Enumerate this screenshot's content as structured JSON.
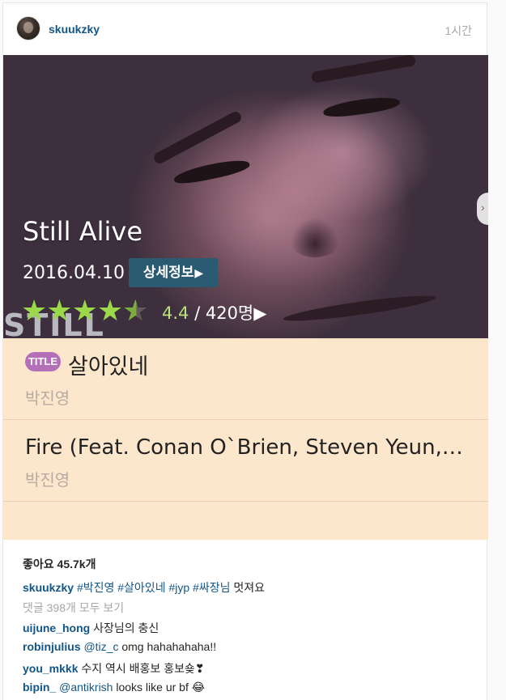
{
  "post": {
    "username": "skuukzky",
    "time_ago": "1시간"
  },
  "photo": {
    "still_letters": "STILL",
    "album_title": "Still Alive",
    "release_date": "2016.04.10",
    "detail_button": "상세정보",
    "detail_arrow": "▶",
    "rating_stars": 4.4,
    "rating_value": "4.4",
    "rating_count": "/ 420명▶",
    "rating_color": "#9bd84a",
    "tracks": [
      {
        "badge": "TITLE",
        "name": "살아있네",
        "artist": "박진영"
      },
      {
        "name": "Fire (Feat. Conan O`Brien, Steven Yeun,…",
        "artist": "박진영"
      }
    ]
  },
  "meta": {
    "likes": "좋아요 45.7k개",
    "caption": {
      "username": "skuukzky",
      "tags": [
        "#박진영",
        "#살아있네",
        "#jyp",
        "#싸장님"
      ],
      "text": "멋져요"
    },
    "view_comments": "댓글 398개 모두 보기",
    "comments": [
      {
        "username": "uijune_hong",
        "mention": "",
        "text": "사장님의 충신"
      },
      {
        "username": "robinjulius",
        "mention": "@tiz_c",
        "text": "omg hahahahaha!!"
      },
      {
        "username": "you_mkkk",
        "mention": "",
        "text": "수지 역시 배홍보 홍보숒❣"
      },
      {
        "username": "bipin_",
        "mention": "@antikrish",
        "text": "looks like ur bf 😂"
      }
    ]
  }
}
